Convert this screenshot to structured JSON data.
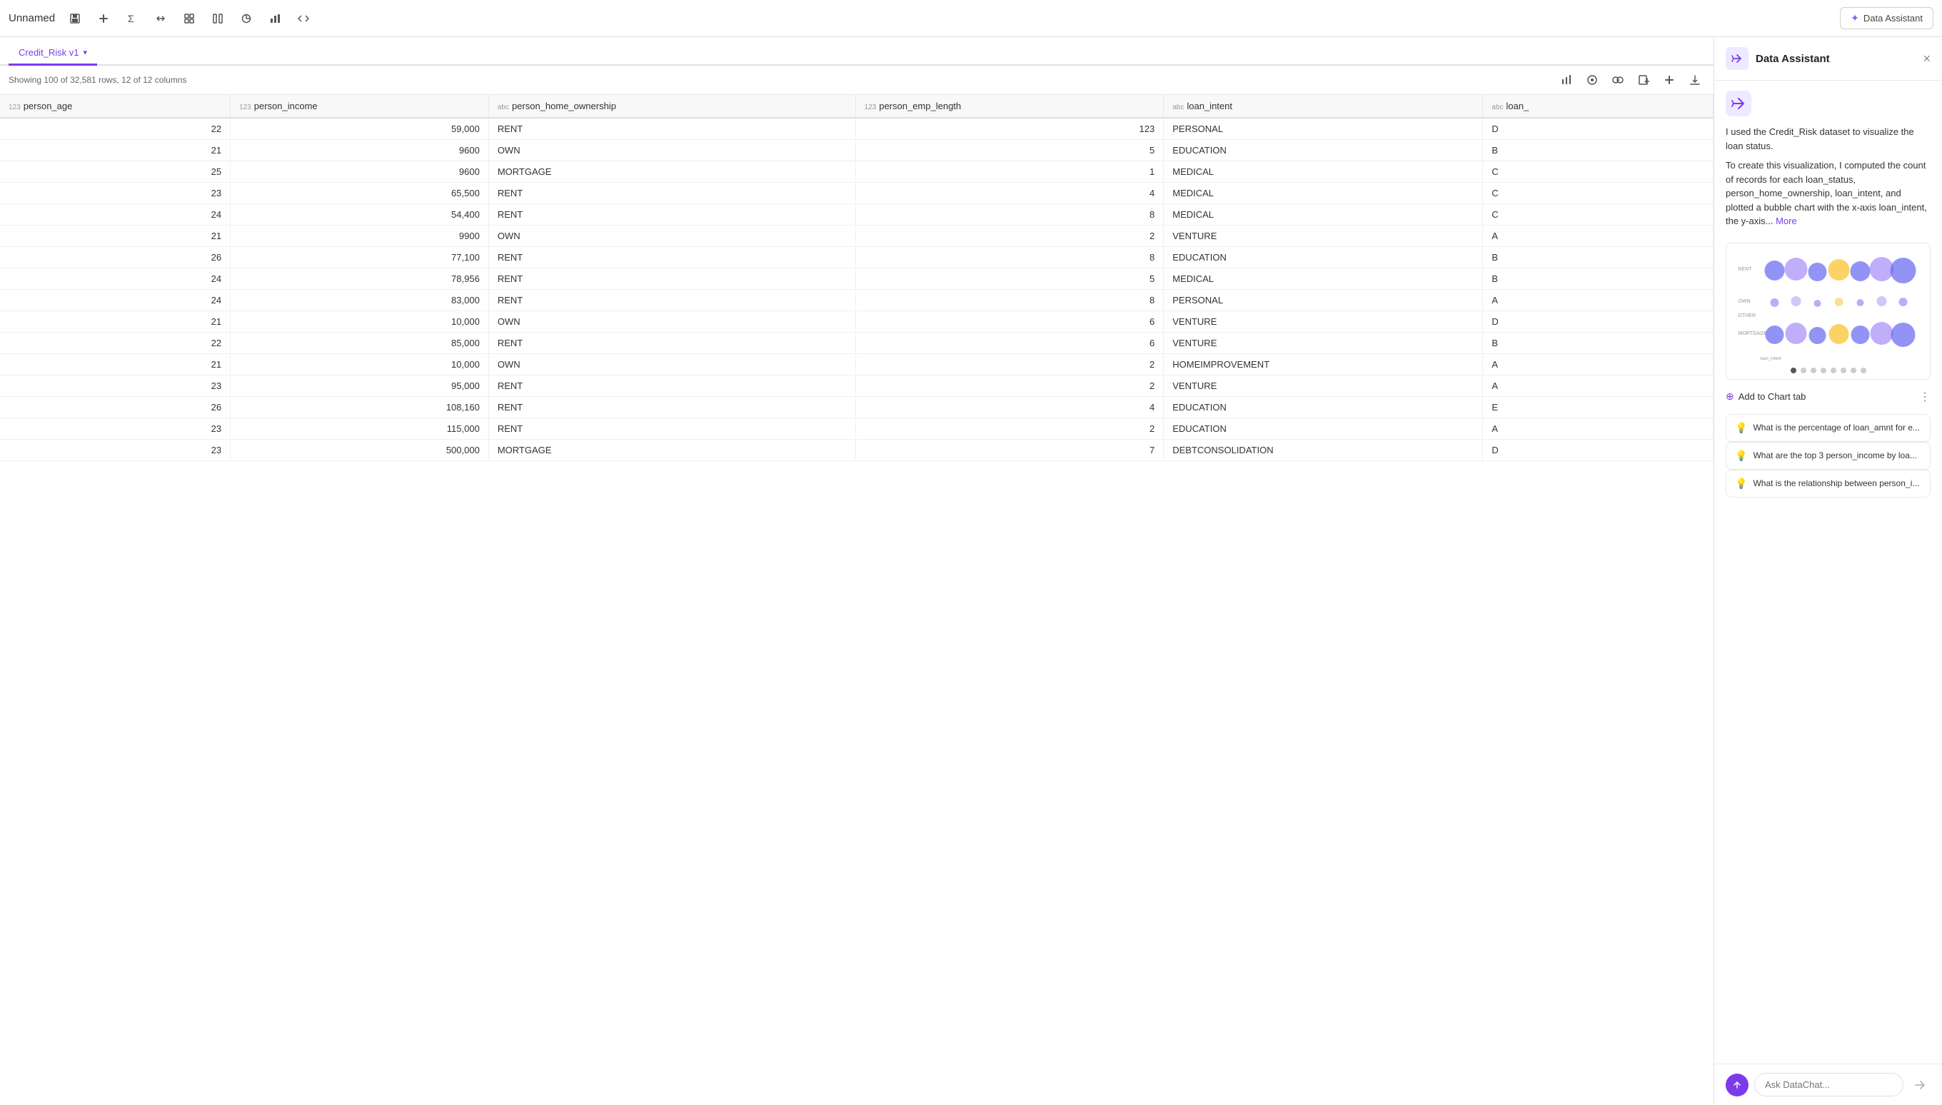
{
  "toolbar": {
    "title": "Unnamed",
    "data_assistant_label": "Data Assistant"
  },
  "tab": {
    "name": "Credit_Risk v1",
    "dropdown": "▾"
  },
  "dataset_info": {
    "text": "Showing 100 of 32,581 rows, 12 of 12 columns"
  },
  "table": {
    "columns": [
      {
        "type": "123",
        "name": "person_age"
      },
      {
        "type": "123",
        "name": "person_income"
      },
      {
        "type": "abc",
        "name": "person_home_ownership"
      },
      {
        "type": "123",
        "name": "person_emp_length"
      },
      {
        "type": "abc",
        "name": "loan_intent"
      },
      {
        "type": "abc",
        "name": "loan_"
      }
    ],
    "rows": [
      {
        "age": "22",
        "income": "59,000",
        "home": "RENT",
        "emp": "123",
        "intent": "PERSONAL",
        "loan": "D"
      },
      {
        "age": "21",
        "income": "9600",
        "home": "OWN",
        "emp": "5",
        "intent": "EDUCATION",
        "loan": "B"
      },
      {
        "age": "25",
        "income": "9600",
        "home": "MORTGAGE",
        "emp": "1",
        "intent": "MEDICAL",
        "loan": "C"
      },
      {
        "age": "23",
        "income": "65,500",
        "home": "RENT",
        "emp": "4",
        "intent": "MEDICAL",
        "loan": "C"
      },
      {
        "age": "24",
        "income": "54,400",
        "home": "RENT",
        "emp": "8",
        "intent": "MEDICAL",
        "loan": "C"
      },
      {
        "age": "21",
        "income": "9900",
        "home": "OWN",
        "emp": "2",
        "intent": "VENTURE",
        "loan": "A"
      },
      {
        "age": "26",
        "income": "77,100",
        "home": "RENT",
        "emp": "8",
        "intent": "EDUCATION",
        "loan": "B"
      },
      {
        "age": "24",
        "income": "78,956",
        "home": "RENT",
        "emp": "5",
        "intent": "MEDICAL",
        "loan": "B"
      },
      {
        "age": "24",
        "income": "83,000",
        "home": "RENT",
        "emp": "8",
        "intent": "PERSONAL",
        "loan": "A"
      },
      {
        "age": "21",
        "income": "10,000",
        "home": "OWN",
        "emp": "6",
        "intent": "VENTURE",
        "loan": "D"
      },
      {
        "age": "22",
        "income": "85,000",
        "home": "RENT",
        "emp": "6",
        "intent": "VENTURE",
        "loan": "B"
      },
      {
        "age": "21",
        "income": "10,000",
        "home": "OWN",
        "emp": "2",
        "intent": "HOMEIMPROVEMENT",
        "loan": "A"
      },
      {
        "age": "23",
        "income": "95,000",
        "home": "RENT",
        "emp": "2",
        "intent": "VENTURE",
        "loan": "A"
      },
      {
        "age": "26",
        "income": "108,160",
        "home": "RENT",
        "emp": "4",
        "intent": "EDUCATION",
        "loan": "E"
      },
      {
        "age": "23",
        "income": "115,000",
        "home": "RENT",
        "emp": "2",
        "intent": "EDUCATION",
        "loan": "A"
      },
      {
        "age": "23",
        "income": "500,000",
        "home": "MORTGAGE",
        "emp": "7",
        "intent": "DEBTCONSOLIDATION",
        "loan": "D"
      }
    ]
  },
  "assistant": {
    "title": "Data Assistant",
    "close_label": "×",
    "message1": "I used the Credit_Risk dataset to visualize the loan status.",
    "message2": "To create this visualization, I computed the count of records for each loan_status, person_home_ownership, loan_intent, and plotted a bubble chart with the x-axis loan_intent, the y-axis...",
    "more_link": "More",
    "add_to_chart_label": "Add to Chart tab",
    "suggestions": [
      "What is the percentage of loan_amnt for e...",
      "What are the top 3 person_income by loa...",
      "What is the relationship between person_i..."
    ],
    "chat_placeholder": "Ask DataChat...",
    "chart_dots": 8,
    "chart_active_dot": 0
  }
}
